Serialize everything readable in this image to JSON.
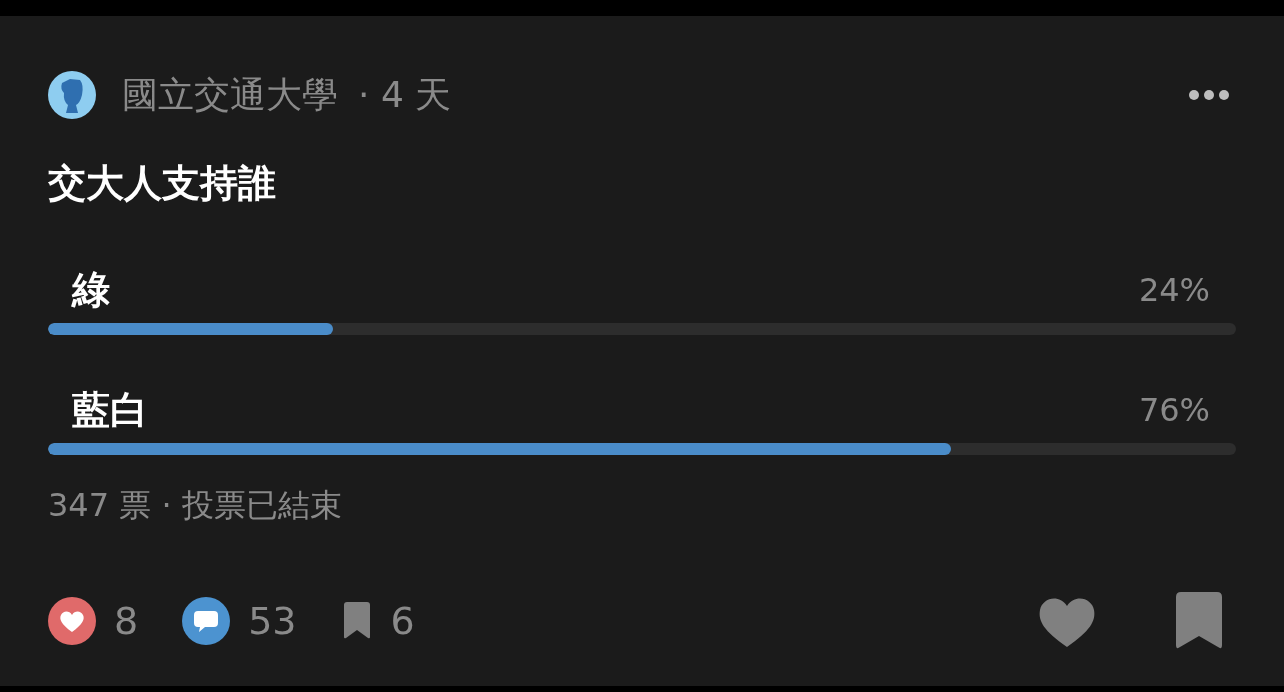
{
  "author": {
    "name": "國立交通大學",
    "age": "· 4 天"
  },
  "poll": {
    "question": "交大人支持誰",
    "options": [
      {
        "label": "綠",
        "percent": "24%",
        "level": 0.24
      },
      {
        "label": "藍白",
        "percent": "76%",
        "level": 0.76
      }
    ],
    "summary": "347 票 · 投票已結束"
  },
  "reactions": [
    {
      "kind": "like",
      "count": "8"
    },
    {
      "kind": "comment",
      "count": "53"
    },
    {
      "kind": "save",
      "count": "6"
    }
  ],
  "actions": [
    {
      "kind": "like"
    },
    {
      "kind": "save"
    }
  ]
}
